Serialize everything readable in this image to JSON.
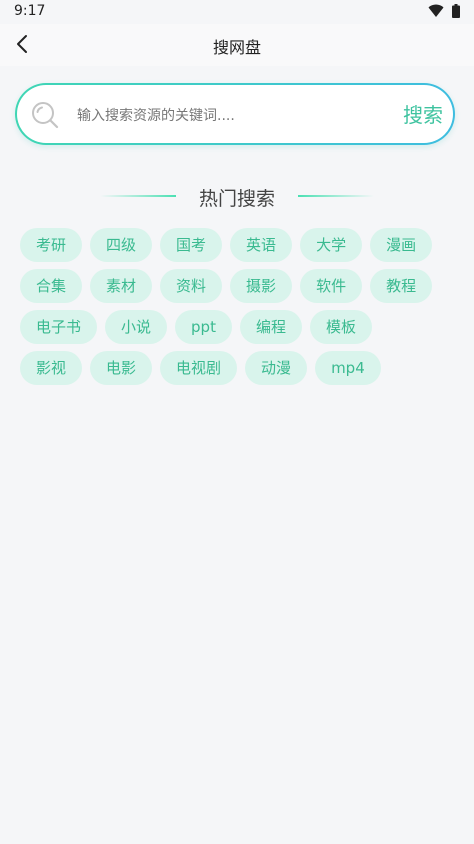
{
  "status_bar": {
    "time": "9:17"
  },
  "app_bar": {
    "title": "搜网盘"
  },
  "search": {
    "placeholder": "输入搜索资源的关键词....",
    "value": "",
    "submit_label": "搜索"
  },
  "hot": {
    "title": "热门搜索",
    "rows": [
      [
        "考研",
        "四级",
        "国考",
        "英语",
        "大学",
        "漫画"
      ],
      [
        "合集",
        "素材",
        "资料",
        "摄影",
        "软件",
        "教程"
      ],
      [
        "电子书",
        "小说",
        "ppt",
        "编程",
        "模板"
      ],
      [
        "影视",
        "电影",
        "电视剧",
        "动漫",
        "mp4"
      ]
    ]
  },
  "colors": {
    "accent": "#3aba90",
    "tag_bg": "#d9f4ec",
    "border_start": "#3fd6b4",
    "border_end": "#3ebde0"
  },
  "icons": [
    "wifi-icon",
    "battery-icon",
    "back-arrow-icon",
    "search-icon"
  ]
}
